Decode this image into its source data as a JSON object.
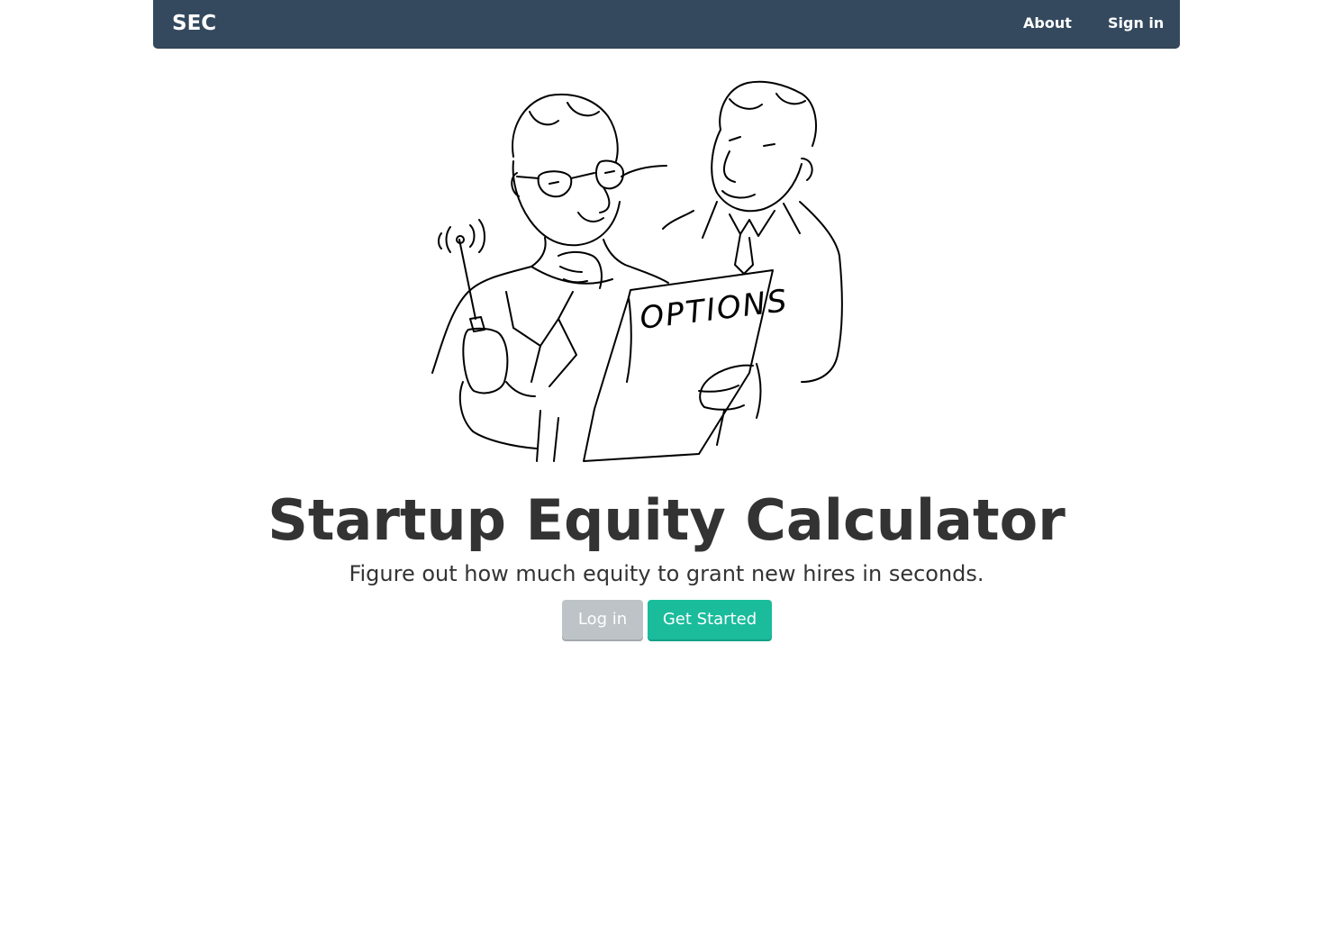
{
  "navbar": {
    "brand": "SEC",
    "links": [
      {
        "label": "About"
      },
      {
        "label": "Sign in"
      }
    ],
    "background_color": "#34495e"
  },
  "hero": {
    "illustration": {
      "icon": "two-businessmen-options-cartoon",
      "sign_text": "OPTIONS"
    },
    "title": "Startup Equity Calculator",
    "subtitle": "Figure out how much equity to grant new hires in seconds.",
    "buttons": {
      "login_label": "Log in",
      "get_started_label": "Get Started"
    },
    "colors": {
      "login_button": "#bdc3c7",
      "get_started_button": "#1abc9c",
      "text": "#333333"
    }
  }
}
